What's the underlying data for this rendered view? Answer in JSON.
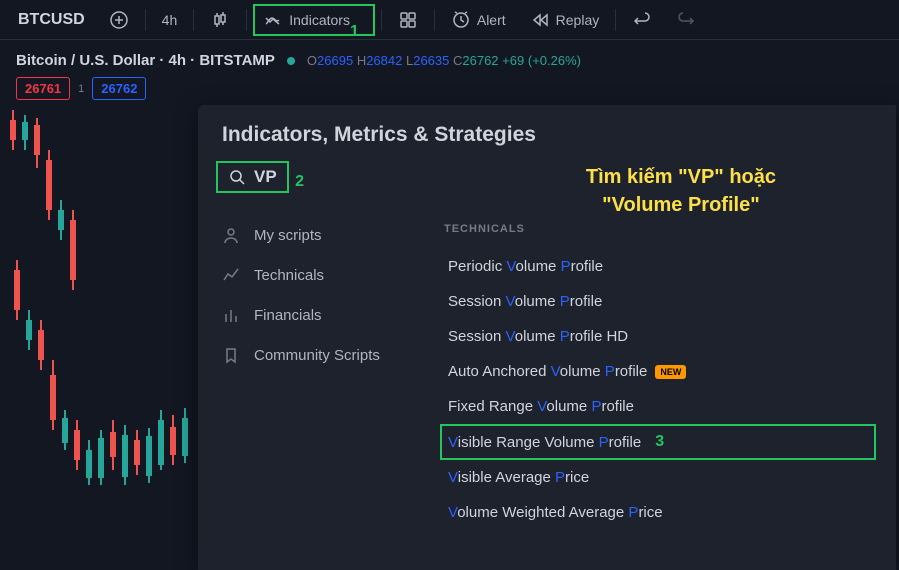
{
  "toolbar": {
    "symbol": "BTCUSD",
    "interval": "4h",
    "indicators_label": "Indicators",
    "alert_label": "Alert",
    "replay_label": "Replay"
  },
  "chart_header": {
    "pair": "Bitcoin / U.S. Dollar · 4h · BITSTAMP",
    "open_label": "O",
    "open": "26695",
    "high_label": "H",
    "high": "26842",
    "low_label": "L",
    "low": "26635",
    "close_label": "C",
    "close": "26762",
    "change": "+69",
    "change_pct": "(+0.26%)"
  },
  "prices": {
    "bid": "26761",
    "sep": "1",
    "ask": "26762"
  },
  "modal": {
    "title": "Indicators, Metrics & Strategies",
    "search_value": "VP",
    "annotation_line1": "Tìm kiếm \"VP\" hoặc",
    "annotation_line2": "\"Volume Profile\"",
    "sidebar": {
      "my_scripts": "My scripts",
      "technicals": "Technicals",
      "financials": "Financials",
      "community": "Community Scripts"
    },
    "section_label": "TECHNICALS",
    "results": [
      {
        "pre": "Periodic ",
        "hlV": "V",
        "mid1": "olume ",
        "hlP": "P",
        "post": "rofile"
      },
      {
        "pre": "Session ",
        "hlV": "V",
        "mid1": "olume ",
        "hlP": "P",
        "post": "rofile"
      },
      {
        "pre": "Session ",
        "hlV": "V",
        "mid1": "olume ",
        "hlP": "P",
        "post": "rofile HD"
      },
      {
        "pre": "Auto Anchored ",
        "hlV": "V",
        "mid1": "olume ",
        "hlP": "P",
        "post": "rofile",
        "new": "NEW"
      },
      {
        "pre": "Fixed Range ",
        "hlV": "V",
        "mid1": "olume ",
        "hlP": "P",
        "post": "rofile"
      },
      {
        "preHl": "V",
        "pre2": "isible Range Volume ",
        "hlP": "P",
        "post": "rofile",
        "highlighted": true
      },
      {
        "preHl": "V",
        "pre2": "isible Average ",
        "hlP": "P",
        "post": "rice"
      },
      {
        "preHl": "V",
        "pre2": "olume Weighted Average ",
        "hlP": "P",
        "post": "rice"
      }
    ],
    "highlight_numbers": {
      "n1": "1",
      "n2": "2",
      "n3": "3"
    }
  }
}
